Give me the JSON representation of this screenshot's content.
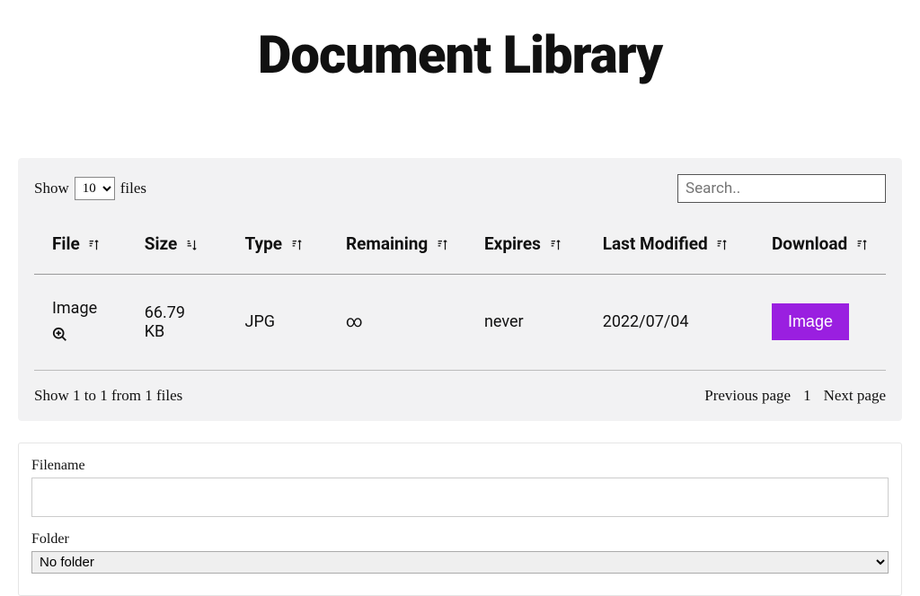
{
  "title": "Document Library",
  "controls": {
    "show_label": "Show",
    "show_value": "10",
    "files_label": "files",
    "search_placeholder": "Search.."
  },
  "columns": {
    "file": "File",
    "size": "Size",
    "type": "Type",
    "remaining": "Remaining",
    "expires": "Expires",
    "last_modified": "Last Modified",
    "download": "Download"
  },
  "rows": [
    {
      "file": "Image",
      "size": "66.79 KB",
      "type": "JPG",
      "remaining": "∞",
      "expires": "never",
      "last_modified": "2022/07/04",
      "download_label": "Image"
    }
  ],
  "footer": {
    "status": "Show 1 to 1 from 1 files",
    "prev": "Previous page",
    "page": "1",
    "next": "Next page"
  },
  "form": {
    "filename_label": "Filename",
    "filename_value": "",
    "folder_label": "Folder",
    "folder_value": "No folder"
  }
}
